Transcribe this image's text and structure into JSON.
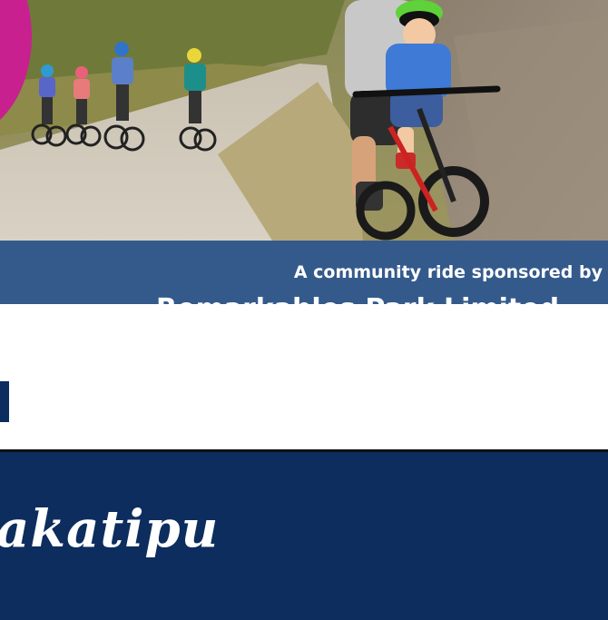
{
  "hero": {
    "image_label": "Riders on a gravel trail with an adult and child on a bike"
  },
  "sponsor": {
    "line1": "A community ride sponsored by",
    "line2": "Remarkables Park Limited"
  },
  "footer": {
    "logo_text": "akatipu"
  },
  "colors": {
    "banner_blue": "#345a8c",
    "footer_navy": "#0c2d5e",
    "accent_pink": "#c8208f"
  }
}
